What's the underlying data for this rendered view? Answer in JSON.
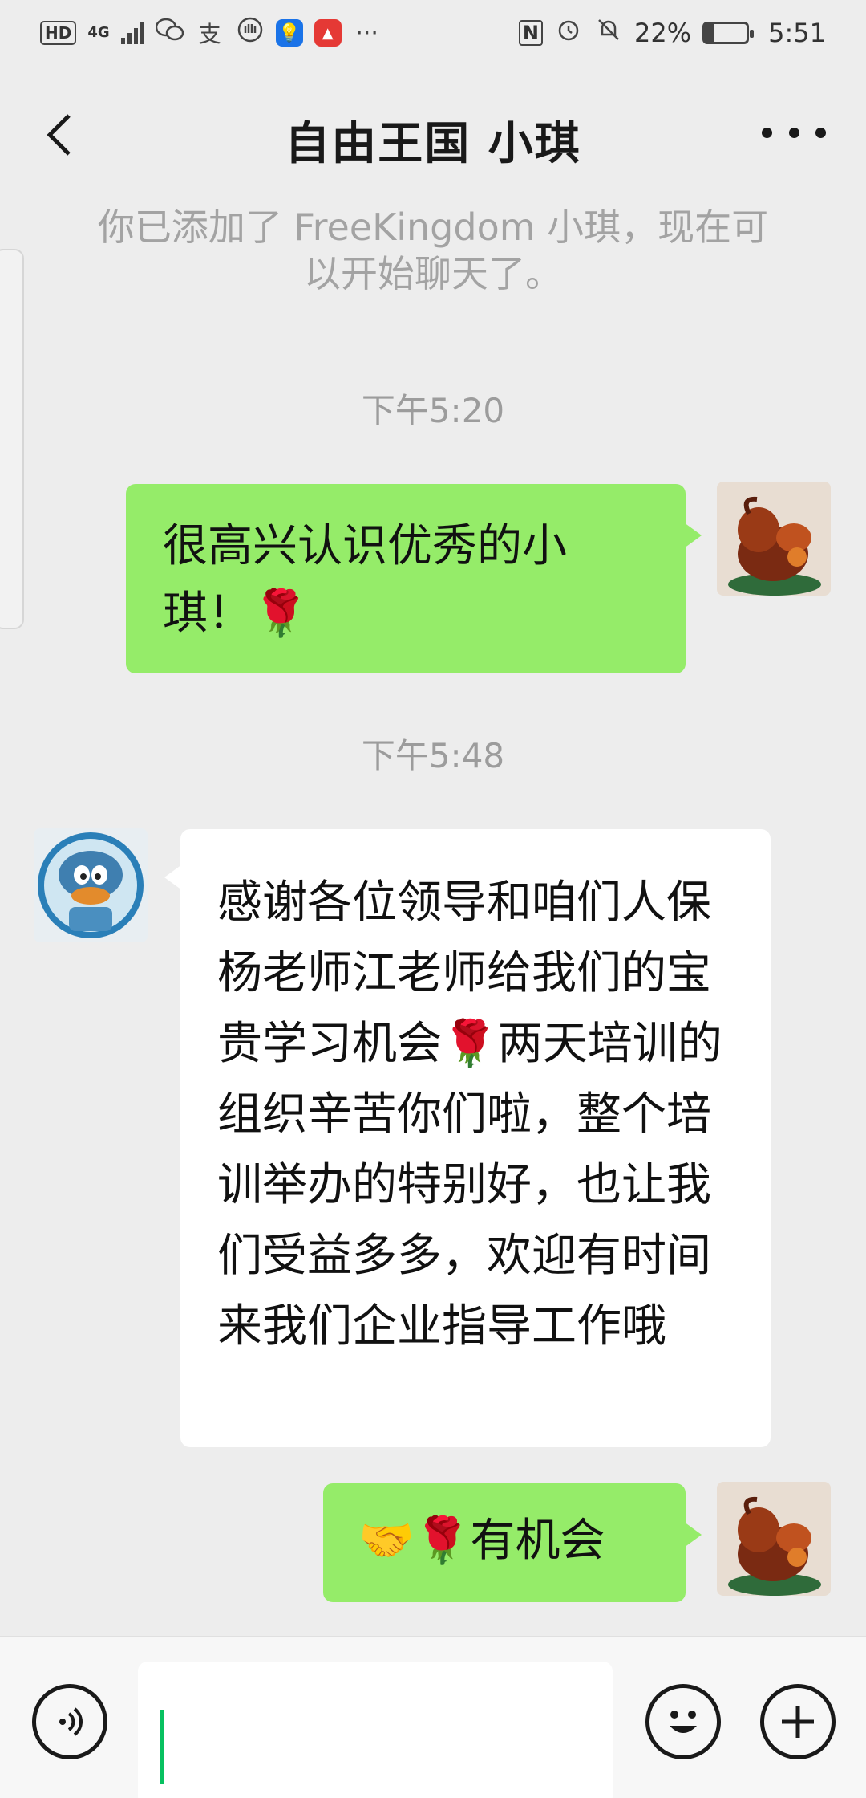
{
  "status_bar": {
    "hd": "HD",
    "network": "4G",
    "battery": "22%",
    "battery_level": 0.22,
    "time": "5:51",
    "nfc": "N"
  },
  "header": {
    "title": "自由王国 小琪"
  },
  "system_notice": "你已添加了 FreeKingdom 小琪，现在可以开始聊天了。",
  "messages": [
    {
      "type": "time",
      "text": "下午5:20"
    },
    {
      "type": "sent",
      "text": "很高兴认识优秀的小琪！🌹"
    },
    {
      "type": "time",
      "text": "下午5:48"
    },
    {
      "type": "received",
      "text": "感谢各位领导和咱们人保杨老师江老师给我们的宝贵学习机会🌹两天培训的组织辛苦你们啦，整个培训举办的特别好，也让我们受益多多，欢迎有时间来我们企业指导工作哦"
    },
    {
      "type": "sent",
      "text": "🤝🌹有机会"
    }
  ],
  "input_bar": {
    "voice_icon": "voice-icon",
    "emoji_icon": "emoji-icon",
    "plus_icon": "plus-icon",
    "caret_color": "#07c160"
  },
  "colors": {
    "sent_bubble": "#95ec69",
    "received_bubble": "#ffffff",
    "background": "#ededed"
  }
}
